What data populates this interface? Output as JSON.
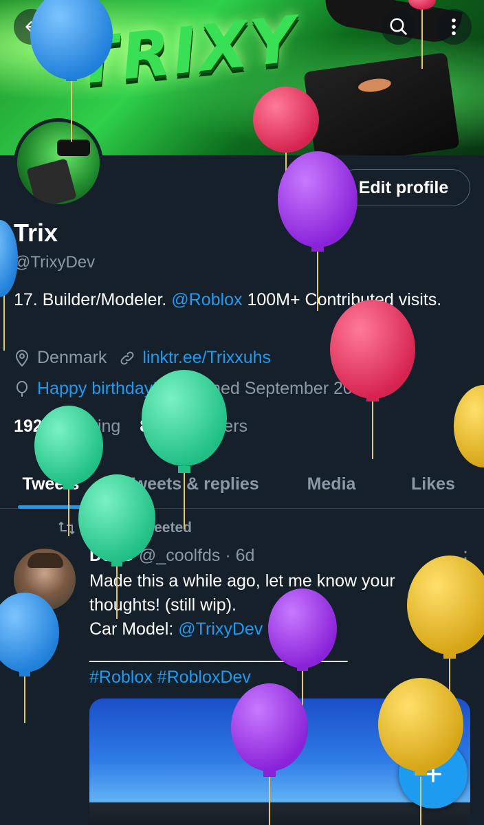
{
  "banner": {
    "title": "TRIXY"
  },
  "top_bar": {
    "back_icon": "arrow-left-icon",
    "search_icon": "search-icon",
    "more_icon": "more-vertical-icon"
  },
  "profile": {
    "edit_label": "Edit profile",
    "name": "Trix",
    "handle": "@TrixyDev",
    "bio_start": "17. Builder/Modeler. ",
    "bio_mention": "@Roblox",
    "bio_end": " 100M+ Contributed visits.",
    "location": "Denmark",
    "url": "linktr.ee/Trixxuhs",
    "birthday": "Happy birthday!",
    "joined": "Joined September 2019",
    "following_count": "192",
    "following_label": "Following",
    "followers_count": "853",
    "followers_label": "Followers"
  },
  "tabs": [
    {
      "label": "Tweets",
      "active": true
    },
    {
      "label": "Tweets & replies",
      "active": false
    },
    {
      "label": "Media",
      "active": false
    },
    {
      "label": "Likes",
      "active": false
    }
  ],
  "tweet": {
    "retweet_label": "You Retweeted",
    "display_name": "DevC",
    "username": "@_coolfds · 6d",
    "more": "⋮",
    "line1": "Made this a while ago, let me know your thoughts! (still wip).",
    "line2_prefix": "Car Model: ",
    "line2_mention": "@TrixyDev",
    "line2_suffix": " (💜)",
    "divider": "___________________________",
    "hashtags": "#Roblox #RobloxDev"
  },
  "fab": {
    "label": "+"
  },
  "colors": {
    "background": "#15202b",
    "accent": "#1d9bf0",
    "muted": "#8b98a5",
    "border": "#38444d"
  }
}
